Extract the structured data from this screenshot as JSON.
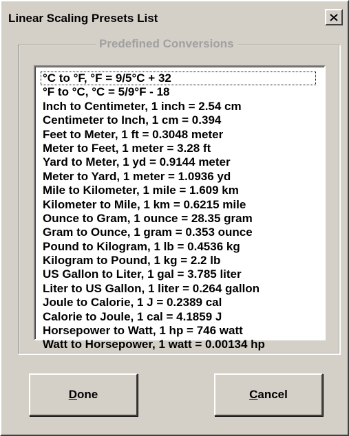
{
  "window": {
    "title": "Linear Scaling Presets List"
  },
  "icons": {
    "close": "close-icon"
  },
  "group": {
    "label": "Predefined Conversions"
  },
  "list": {
    "items": [
      "°C to °F, °F = 9/5°C + 32",
      "°F to °C, °C = 5/9°F - 18",
      "Inch to Centimeter, 1 inch = 2.54 cm",
      "Centimeter to Inch, 1 cm = 0.394",
      "Feet to Meter, 1 ft = 0.3048 meter",
      "Meter to Feet, 1 meter = 3.28 ft",
      "Yard to Meter, 1 yd = 0.9144 meter",
      "Meter to Yard, 1 meter = 1.0936 yd",
      "Mile to Kilometer, 1 mile = 1.609 km",
      "Kilometer to Mile, 1 km = 0.6215 mile",
      "Ounce to Gram, 1 ounce = 28.35 gram",
      "Gram to Ounce, 1 gram = 0.353 ounce",
      "Pound to Kilogram, 1 lb = 0.4536 kg",
      "Kilogram to Pound, 1 kg = 2.2 lb",
      "US Gallon to Liter, 1 gal = 3.785 liter",
      "Liter to US Gallon, 1 liter = 0.264 gallon",
      "Joule to Calorie, 1 J = 0.2389 cal",
      "Calorie to Joule, 1 cal = 4.1859 J",
      "Horsepower to Watt, 1 hp = 746 watt",
      "Watt to Horsepower, 1 watt = 0.00134 hp"
    ]
  },
  "buttons": {
    "done": {
      "mnemonic": "D",
      "rest": "one"
    },
    "cancel": {
      "mnemonic": "C",
      "rest": "ancel"
    }
  }
}
